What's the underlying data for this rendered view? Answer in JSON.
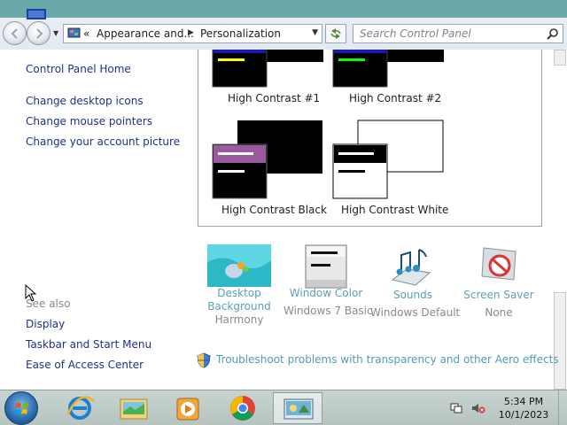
{
  "titlebar": {
    "breadcrumb": [
      "Appearance and...",
      "Personalization"
    ],
    "breadcrumb_prefix": "«",
    "search_placeholder": "Search Control Panel"
  },
  "left_pane": {
    "home_link": "Control Panel Home",
    "tasks": [
      "Change desktop icons",
      "Change mouse pointers",
      "Change your account picture"
    ],
    "see_also_heading": "See also",
    "see_also_links": [
      "Display",
      "Taskbar and Start Menu",
      "Ease of Access Center"
    ]
  },
  "themes": [
    {
      "name": "High Contrast #1",
      "accent": "#ffff00"
    },
    {
      "name": "High Contrast #2",
      "accent": "#00ff00"
    },
    {
      "name": "High Contrast Black",
      "accent": "#9a5aa0"
    },
    {
      "name": "High Contrast White",
      "accent": "#000000"
    }
  ],
  "bottom_items": [
    {
      "title_line1": "Desktop",
      "title_line2": "Background",
      "subtitle": "Harmony",
      "icon": "desktop-background-icon"
    },
    {
      "title_line1": "Window Color",
      "subtitle": "Windows 7 Basic",
      "icon": "window-color-icon"
    },
    {
      "title_line1": "Sounds",
      "subtitle": "Windows Default",
      "icon": "sounds-icon"
    },
    {
      "title_line1": "Screen Saver",
      "subtitle": "None",
      "icon": "screen-saver-icon"
    }
  ],
  "troubleshoot_link": "Troubleshoot problems with transparency and other Aero effects",
  "taskbar": {
    "apps": [
      "internet-explorer-icon",
      "windows-explorer-icon",
      "media-player-icon",
      "chrome-icon",
      "control-panel-icon"
    ],
    "time": "5:34 PM",
    "date": "10/1/2023"
  },
  "colors": {
    "link": "#1e3287",
    "caption": "#6aa9a9",
    "muted_link": "#5aa0b8"
  }
}
